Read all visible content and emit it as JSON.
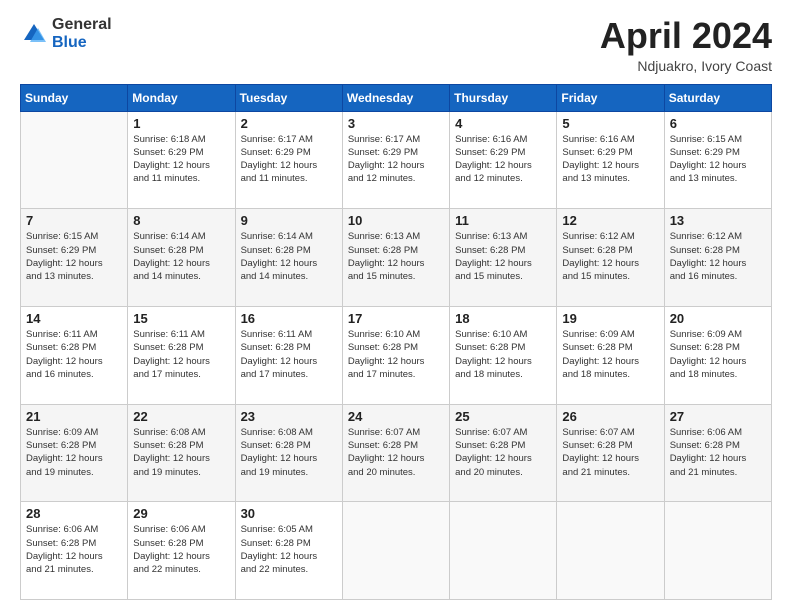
{
  "header": {
    "logo_general": "General",
    "logo_blue": "Blue",
    "month_title": "April 2024",
    "location": "Ndjuakro, Ivory Coast"
  },
  "weekdays": [
    "Sunday",
    "Monday",
    "Tuesday",
    "Wednesday",
    "Thursday",
    "Friday",
    "Saturday"
  ],
  "weeks": [
    [
      {
        "day": "",
        "info": ""
      },
      {
        "day": "1",
        "info": "Sunrise: 6:18 AM\nSunset: 6:29 PM\nDaylight: 12 hours\nand 11 minutes."
      },
      {
        "day": "2",
        "info": "Sunrise: 6:17 AM\nSunset: 6:29 PM\nDaylight: 12 hours\nand 11 minutes."
      },
      {
        "day": "3",
        "info": "Sunrise: 6:17 AM\nSunset: 6:29 PM\nDaylight: 12 hours\nand 12 minutes."
      },
      {
        "day": "4",
        "info": "Sunrise: 6:16 AM\nSunset: 6:29 PM\nDaylight: 12 hours\nand 12 minutes."
      },
      {
        "day": "5",
        "info": "Sunrise: 6:16 AM\nSunset: 6:29 PM\nDaylight: 12 hours\nand 13 minutes."
      },
      {
        "day": "6",
        "info": "Sunrise: 6:15 AM\nSunset: 6:29 PM\nDaylight: 12 hours\nand 13 minutes."
      }
    ],
    [
      {
        "day": "7",
        "info": "Sunrise: 6:15 AM\nSunset: 6:29 PM\nDaylight: 12 hours\nand 13 minutes."
      },
      {
        "day": "8",
        "info": "Sunrise: 6:14 AM\nSunset: 6:28 PM\nDaylight: 12 hours\nand 14 minutes."
      },
      {
        "day": "9",
        "info": "Sunrise: 6:14 AM\nSunset: 6:28 PM\nDaylight: 12 hours\nand 14 minutes."
      },
      {
        "day": "10",
        "info": "Sunrise: 6:13 AM\nSunset: 6:28 PM\nDaylight: 12 hours\nand 15 minutes."
      },
      {
        "day": "11",
        "info": "Sunrise: 6:13 AM\nSunset: 6:28 PM\nDaylight: 12 hours\nand 15 minutes."
      },
      {
        "day": "12",
        "info": "Sunrise: 6:12 AM\nSunset: 6:28 PM\nDaylight: 12 hours\nand 15 minutes."
      },
      {
        "day": "13",
        "info": "Sunrise: 6:12 AM\nSunset: 6:28 PM\nDaylight: 12 hours\nand 16 minutes."
      }
    ],
    [
      {
        "day": "14",
        "info": "Sunrise: 6:11 AM\nSunset: 6:28 PM\nDaylight: 12 hours\nand 16 minutes."
      },
      {
        "day": "15",
        "info": "Sunrise: 6:11 AM\nSunset: 6:28 PM\nDaylight: 12 hours\nand 17 minutes."
      },
      {
        "day": "16",
        "info": "Sunrise: 6:11 AM\nSunset: 6:28 PM\nDaylight: 12 hours\nand 17 minutes."
      },
      {
        "day": "17",
        "info": "Sunrise: 6:10 AM\nSunset: 6:28 PM\nDaylight: 12 hours\nand 17 minutes."
      },
      {
        "day": "18",
        "info": "Sunrise: 6:10 AM\nSunset: 6:28 PM\nDaylight: 12 hours\nand 18 minutes."
      },
      {
        "day": "19",
        "info": "Sunrise: 6:09 AM\nSunset: 6:28 PM\nDaylight: 12 hours\nand 18 minutes."
      },
      {
        "day": "20",
        "info": "Sunrise: 6:09 AM\nSunset: 6:28 PM\nDaylight: 12 hours\nand 18 minutes."
      }
    ],
    [
      {
        "day": "21",
        "info": "Sunrise: 6:09 AM\nSunset: 6:28 PM\nDaylight: 12 hours\nand 19 minutes."
      },
      {
        "day": "22",
        "info": "Sunrise: 6:08 AM\nSunset: 6:28 PM\nDaylight: 12 hours\nand 19 minutes."
      },
      {
        "day": "23",
        "info": "Sunrise: 6:08 AM\nSunset: 6:28 PM\nDaylight: 12 hours\nand 19 minutes."
      },
      {
        "day": "24",
        "info": "Sunrise: 6:07 AM\nSunset: 6:28 PM\nDaylight: 12 hours\nand 20 minutes."
      },
      {
        "day": "25",
        "info": "Sunrise: 6:07 AM\nSunset: 6:28 PM\nDaylight: 12 hours\nand 20 minutes."
      },
      {
        "day": "26",
        "info": "Sunrise: 6:07 AM\nSunset: 6:28 PM\nDaylight: 12 hours\nand 21 minutes."
      },
      {
        "day": "27",
        "info": "Sunrise: 6:06 AM\nSunset: 6:28 PM\nDaylight: 12 hours\nand 21 minutes."
      }
    ],
    [
      {
        "day": "28",
        "info": "Sunrise: 6:06 AM\nSunset: 6:28 PM\nDaylight: 12 hours\nand 21 minutes."
      },
      {
        "day": "29",
        "info": "Sunrise: 6:06 AM\nSunset: 6:28 PM\nDaylight: 12 hours\nand 22 minutes."
      },
      {
        "day": "30",
        "info": "Sunrise: 6:05 AM\nSunset: 6:28 PM\nDaylight: 12 hours\nand 22 minutes."
      },
      {
        "day": "",
        "info": ""
      },
      {
        "day": "",
        "info": ""
      },
      {
        "day": "",
        "info": ""
      },
      {
        "day": "",
        "info": ""
      }
    ]
  ]
}
